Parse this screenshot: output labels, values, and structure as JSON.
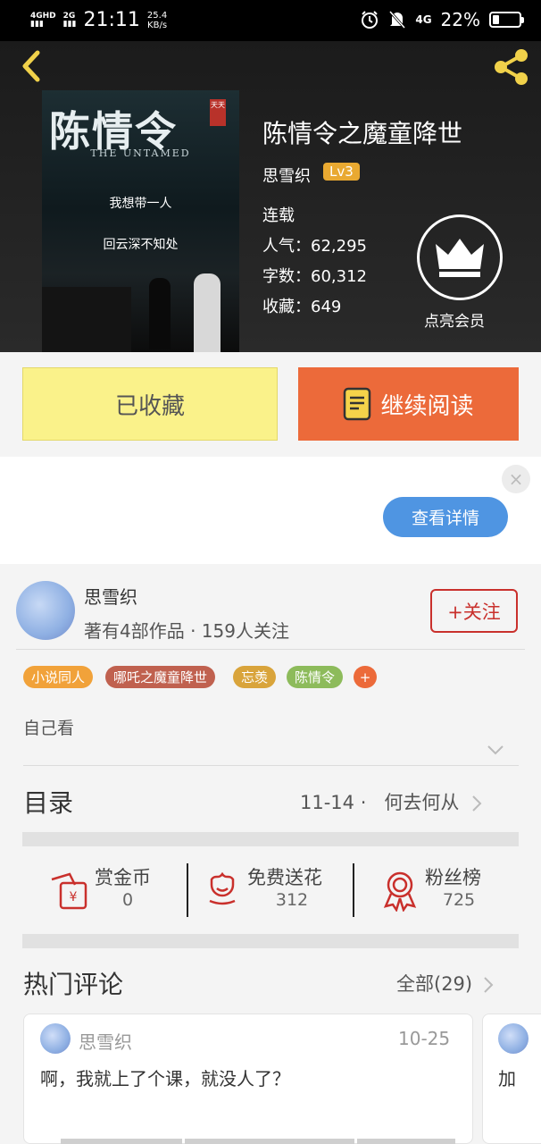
{
  "status_bar": {
    "sig1": "4GHD",
    "sig2": "2G",
    "time": "21:11",
    "speed_value": "25.4",
    "speed_unit": "KB/s",
    "net": "4G",
    "battery": "22%"
  },
  "book": {
    "cover_title": "陈情令",
    "cover_seal": "天天",
    "cover_subtitle": "THE UNTAMED",
    "cover_line1": "我想带一人",
    "cover_line2": "回云深不知处",
    "title": "陈情令之魔童降世",
    "author": "思雪织",
    "level": "Lv3",
    "status": "连载",
    "popularity": "人气：62,295",
    "word_count": "字数：60,312",
    "favorites": "收藏：649",
    "vip_label": "点亮会员"
  },
  "actions": {
    "fav_label": "已收藏",
    "read_label": "继续阅读"
  },
  "ad": {
    "close": "×",
    "detail_label": "查看详情"
  },
  "author_card": {
    "name": "思雪织",
    "stats": "著有4部作品 · 159人关注",
    "follow_label": "+关注"
  },
  "tags": [
    {
      "label": "小说同人",
      "color": "#f1a23a"
    },
    {
      "label": "哪吒之魔童降世",
      "color": "#c0614f"
    },
    {
      "label": "忘羡",
      "color": "#d9a43b"
    },
    {
      "label": "陈情令",
      "color": "#8dbb5b"
    },
    {
      "label": "+",
      "color": "#ec6a3a"
    }
  ],
  "description": "自己看",
  "toc": {
    "label": "目录",
    "latest": "11-14 ·   何去何从"
  },
  "stats": [
    {
      "label": "赏金币",
      "value": "0"
    },
    {
      "label": "免费送花",
      "value": "312"
    },
    {
      "label": "粉丝榜",
      "value": "725"
    }
  ],
  "comments": {
    "section_title": "热门评论",
    "all_label": "全部(29)",
    "items": [
      {
        "user": "思雪织",
        "date": "10-25",
        "text": "啊，我就上了个课，就没人了？"
      },
      {
        "text": "加"
      }
    ]
  },
  "colors": {
    "accent": "#ec6a3a",
    "fav_bg": "#faf28a",
    "follow": "#c9302c",
    "detail": "#4f95e2",
    "icon_red": "#c9302c"
  }
}
